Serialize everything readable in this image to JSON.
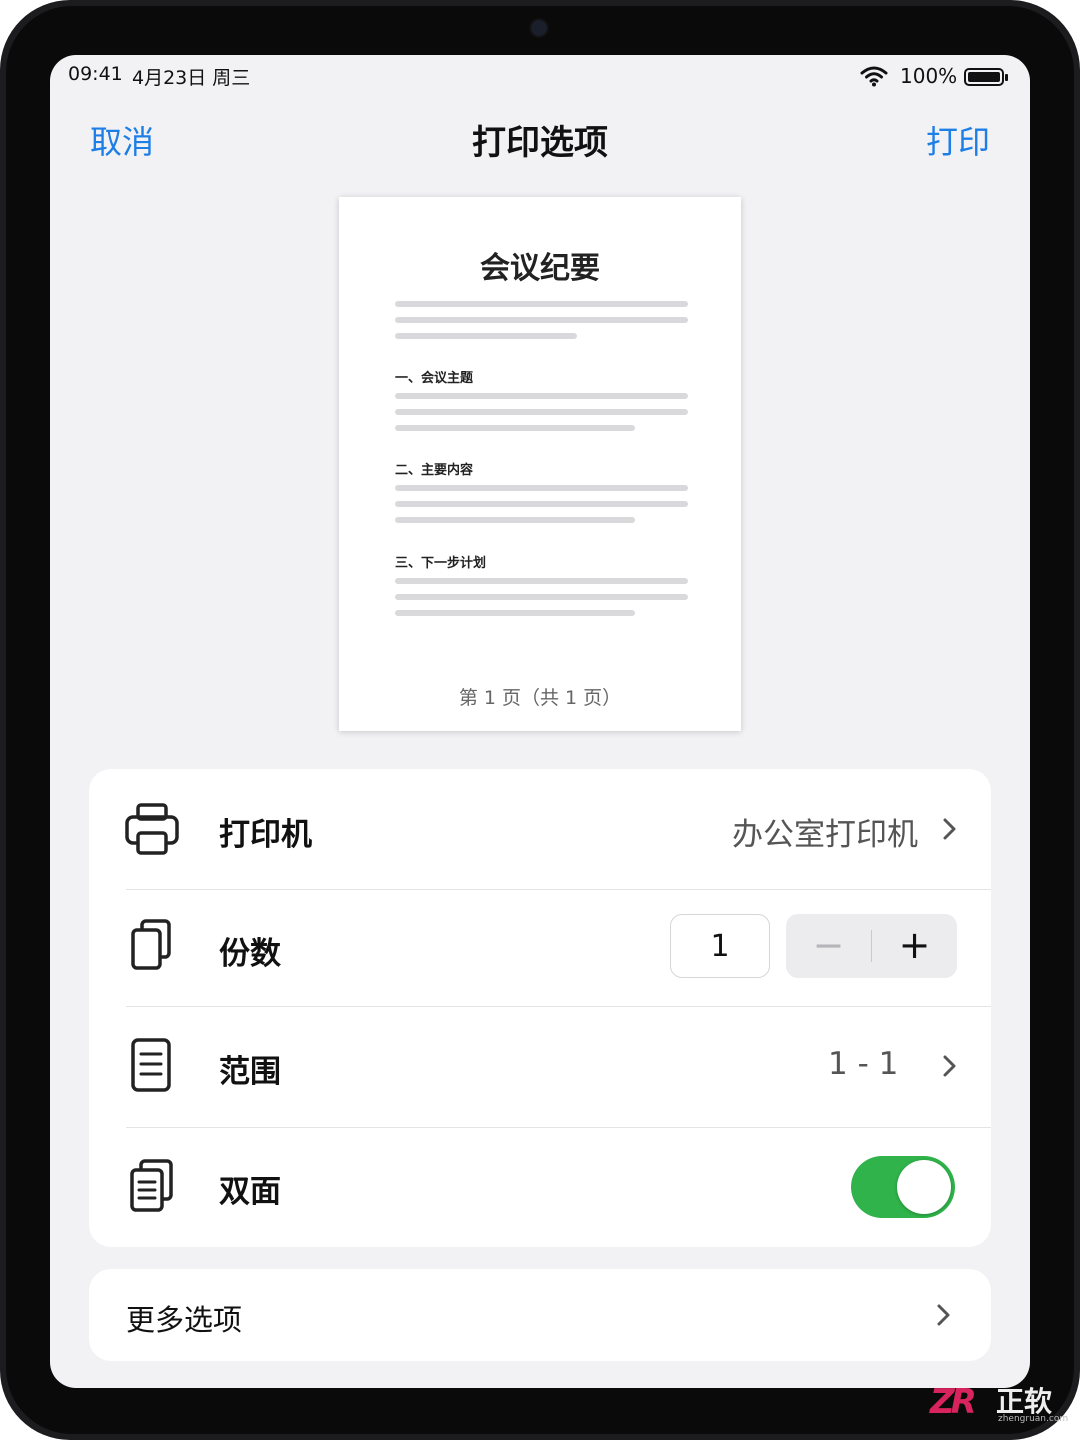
{
  "status_bar": {
    "time": "09:41",
    "date": "4月23日 周三",
    "battery_text": "100%"
  },
  "nav": {
    "cancel": "取消",
    "title": "打印选项",
    "print": "打印"
  },
  "preview": {
    "doc_title": "会议纪要",
    "sections": [
      "一、会议主题",
      "二、主要内容",
      "三、下一步计划"
    ],
    "page_footer": "第 1 页（共 1 页）"
  },
  "options": {
    "printer": {
      "label": "打印机",
      "value": "办公室打印机",
      "icon": "printer-icon"
    },
    "copies": {
      "label": "份数",
      "value": "1",
      "minus": "−",
      "plus": "+",
      "icon": "copies-icon"
    },
    "range": {
      "label": "范围",
      "value": "1 - 1",
      "icon": "document-icon"
    },
    "duplex": {
      "label": "双面",
      "enabled": true,
      "icon": "duplex-icon"
    }
  },
  "more": {
    "label": "更多选项"
  },
  "watermark": {
    "logo": "ZR",
    "text": "正软",
    "sub": "zhengruan.com"
  },
  "colors": {
    "accent": "#1d7ee6",
    "toggle_on": "#2fb34a",
    "background": "#f2f2f5"
  }
}
